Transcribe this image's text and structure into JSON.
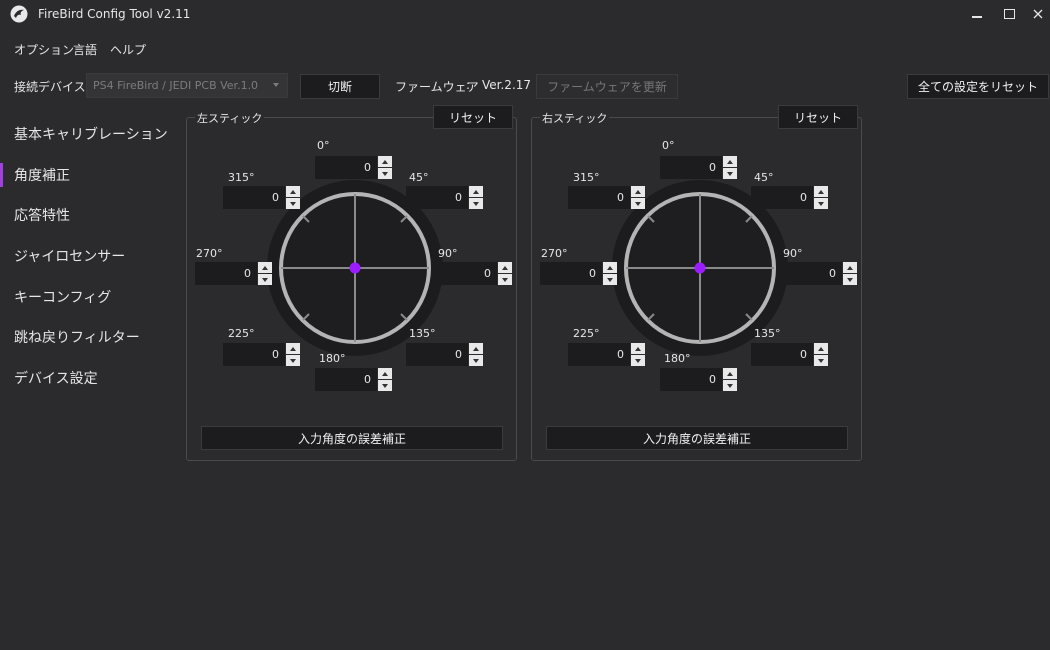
{
  "window": {
    "title": "FireBird Config Tool v2.11"
  },
  "menu": [
    "オプション",
    "言語",
    "ヘルプ"
  ],
  "toolbar": {
    "device_label": "接続デバイス",
    "device_value": "PS4 FireBird / JEDI PCB Ver.1.0",
    "disconnect_label": "切断",
    "firmware_label": "ファームウェア",
    "firmware_sep": ":",
    "firmware_version": "Ver.2.17",
    "update_firmware_label": "ファームウェアを更新",
    "reset_all_label": "全ての設定をリセット"
  },
  "sidebar": {
    "active_index": 1,
    "items": [
      "基本キャリブレーション",
      "角度補正",
      "応答特性",
      "ジャイロセンサー",
      "キーコンフィグ",
      "跳ね戻りフィルター",
      "デバイス設定"
    ]
  },
  "sticks": [
    {
      "title": "左スティック",
      "reset_label": "リセット",
      "calibrate_label": "入力角度の誤差補正",
      "angles": {
        "a0": "0°",
        "a45": "45°",
        "a90": "90°",
        "a135": "135°",
        "a180": "180°",
        "a225": "225°",
        "a270": "270°",
        "a315": "315°"
      },
      "values": {
        "a0": "0",
        "a45": "0",
        "a90": "0",
        "a135": "0",
        "a180": "0",
        "a225": "0",
        "a270": "0",
        "a315": "0"
      }
    },
    {
      "title": "右スティック",
      "reset_label": "リセット",
      "calibrate_label": "入力角度の誤差補正",
      "angles": {
        "a0": "0°",
        "a45": "45°",
        "a90": "90°",
        "a135": "135°",
        "a180": "180°",
        "a225": "225°",
        "a270": "270°",
        "a315": "315°"
      },
      "values": {
        "a0": "0",
        "a45": "0",
        "a90": "0",
        "a135": "0",
        "a180": "0",
        "a225": "0",
        "a270": "0",
        "a315": "0"
      }
    }
  ],
  "colors": {
    "accent": "#a040e0",
    "background": "#2b2b2e",
    "dot": "#9b1dff"
  }
}
